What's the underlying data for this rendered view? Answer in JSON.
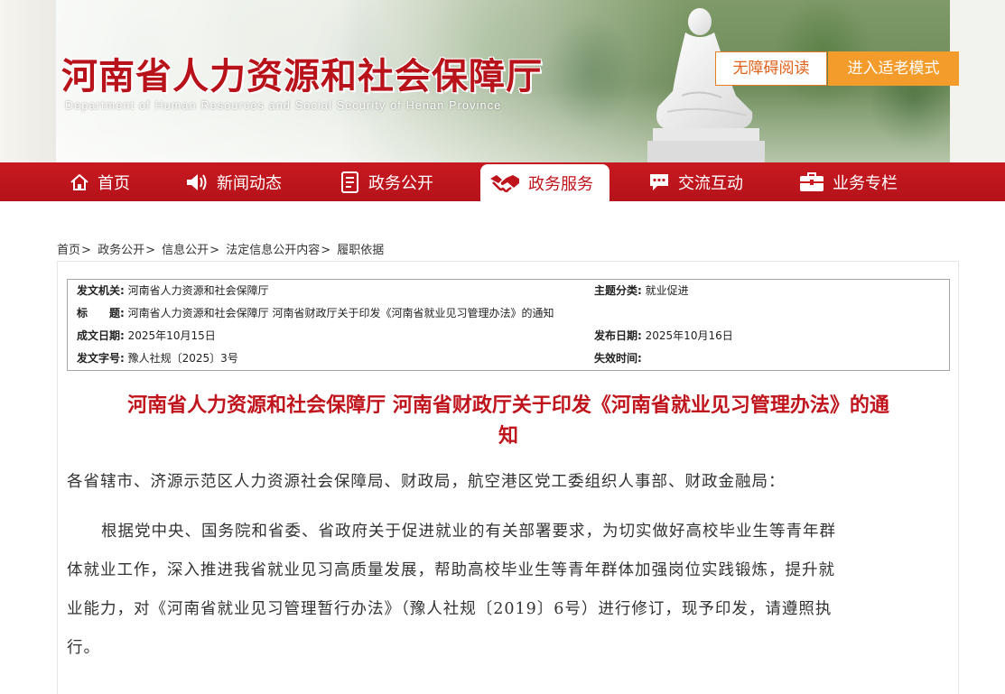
{
  "header": {
    "site_title": "河南省人力资源和社会保障厅",
    "site_subtitle": "Department of Human Resources and Social Security of Henan Province",
    "accessible_reading_label": "无障碍阅读",
    "elder_mode_label": "进入适老模式"
  },
  "nav": {
    "items": [
      {
        "label": "首页",
        "icon": "home-icon"
      },
      {
        "label": "新闻动态",
        "icon": "speaker-icon"
      },
      {
        "label": "政务公开",
        "icon": "document-icon"
      },
      {
        "label": "政务服务",
        "icon": "handshake-icon",
        "active": true
      },
      {
        "label": "交流互动",
        "icon": "chat-icon"
      },
      {
        "label": "业务专栏",
        "icon": "briefcase-icon"
      }
    ]
  },
  "breadcrumb": {
    "items": [
      "首页",
      "政务公开",
      "信息公开",
      "法定信息公开内容",
      "履职依据"
    ],
    "separator": ">"
  },
  "meta": {
    "issuer_label": "发文机关:",
    "issuer_value": "河南省人力资源和社会保障厅",
    "topic_label": "主题分类:",
    "topic_value": "就业促进",
    "title_label": "标　　题:",
    "title_value": "河南省人力资源和社会保障厅 河南省财政厅关于印发《河南省就业见习管理办法》的通知",
    "date_label": "成文日期:",
    "date_value": "2025年10月15日",
    "publish_label": "发布日期:",
    "publish_value": "2025年10月16日",
    "doc_no_label": "发文字号:",
    "doc_no_value": "豫人社规〔2025〕3号",
    "expiry_label": "失效时间:",
    "expiry_value": ""
  },
  "article": {
    "title_line1": "河南省人力资源和社会保障厅 河南省财政厅关于印发《河南省就业见习管理办法》的通",
    "title_line2": "知",
    "salutation": "各省辖市、济源示范区人力资源社会保障局、财政局，航空港区党工委组织人事部、财政金融局：",
    "body_lines": [
      "根据党中央、国务院和省委、省政府关于促进就业的有关部署要求，为切实做好高校毕业生等青年群",
      "体就业工作，深入推进我省就业见习高质量发展，帮助高校毕业生等青年群体加强岗位实践锻炼，提升就",
      "业能力，对《河南省就业见习管理暂行办法》（豫人社规〔2019〕6号）进行修订，现予印发，请遵照执",
      "行。"
    ]
  },
  "colors": {
    "brand_red": "#c0141d",
    "nav_red": "#c81920",
    "accent_orange": "#f39c2c"
  }
}
